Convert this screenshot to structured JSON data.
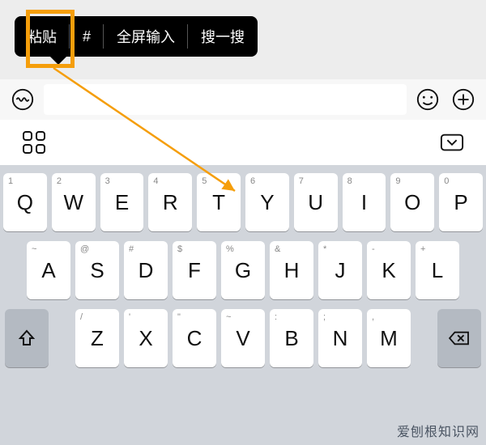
{
  "popup": {
    "paste": "粘贴",
    "hash": "#",
    "fullscreen": "全屏输入",
    "search": "搜一搜"
  },
  "keyboard": {
    "row1": [
      {
        "main": "Q",
        "sec": "1"
      },
      {
        "main": "W",
        "sec": "2"
      },
      {
        "main": "E",
        "sec": "3"
      },
      {
        "main": "R",
        "sec": "4"
      },
      {
        "main": "T",
        "sec": "5"
      },
      {
        "main": "Y",
        "sec": "6"
      },
      {
        "main": "U",
        "sec": "7"
      },
      {
        "main": "I",
        "sec": "8"
      },
      {
        "main": "O",
        "sec": "9"
      },
      {
        "main": "P",
        "sec": "0"
      }
    ],
    "row2": [
      {
        "main": "A",
        "sec": "~"
      },
      {
        "main": "S",
        "sec": "@"
      },
      {
        "main": "D",
        "sec": "#"
      },
      {
        "main": "F",
        "sec": "$"
      },
      {
        "main": "G",
        "sec": "%"
      },
      {
        "main": "H",
        "sec": "&"
      },
      {
        "main": "J",
        "sec": "*"
      },
      {
        "main": "K",
        "sec": "-"
      },
      {
        "main": "L",
        "sec": "+"
      }
    ],
    "row3": [
      {
        "main": "Z",
        "sec": "/"
      },
      {
        "main": "X",
        "sec": "'"
      },
      {
        "main": "C",
        "sec": "\""
      },
      {
        "main": "V",
        "sec": "~"
      },
      {
        "main": "B",
        "sec": ":"
      },
      {
        "main": "N",
        "sec": ";"
      },
      {
        "main": "M",
        "sec": ","
      }
    ]
  },
  "watermark": "爱刨根知识网",
  "colors": {
    "highlight": "#f59e0b",
    "popup_bg": "#000000",
    "kb_bg": "#d1d5db"
  }
}
